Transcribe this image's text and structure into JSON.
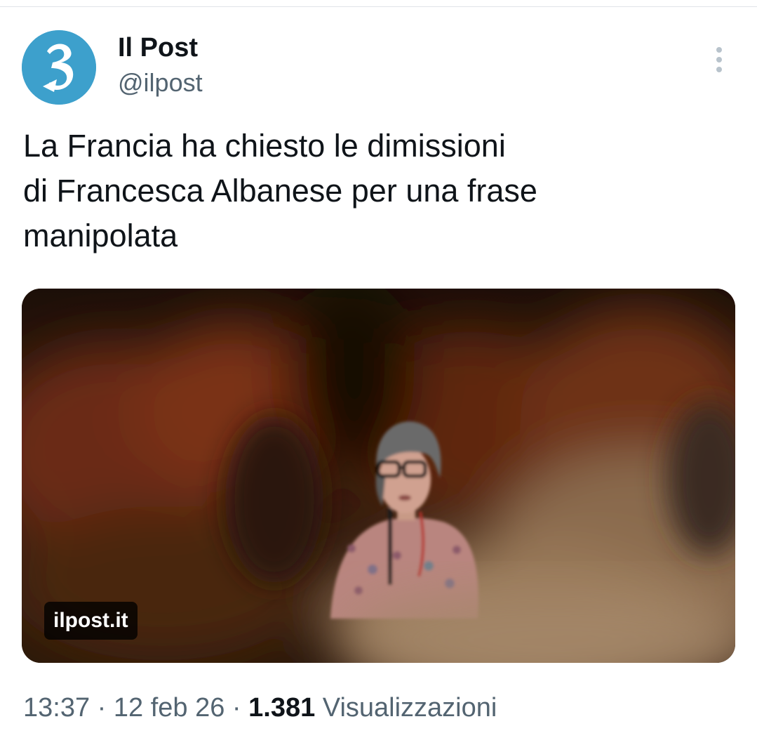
{
  "author": {
    "name": "Il Post",
    "handle": "@ilpost",
    "avatar_icon": "il-post-logo-icon"
  },
  "menu": {
    "icon": "more-vertical-icon"
  },
  "tweet": {
    "text_lines": [
      "La Francia ha chiesto le dimissioni",
      "di Francesca Albanese per una frase",
      "manipolata"
    ]
  },
  "card": {
    "domain": "ilpost.it"
  },
  "meta": {
    "time": "13:37",
    "separator": "·",
    "date": "12 feb 26",
    "views_count": "1.381",
    "views_label": "Visualizzazioni"
  },
  "colors": {
    "avatar_bg": "#3da0cc",
    "primary_text": "#0f1419",
    "secondary_text": "#536471",
    "divider": "#e1e4e8"
  }
}
